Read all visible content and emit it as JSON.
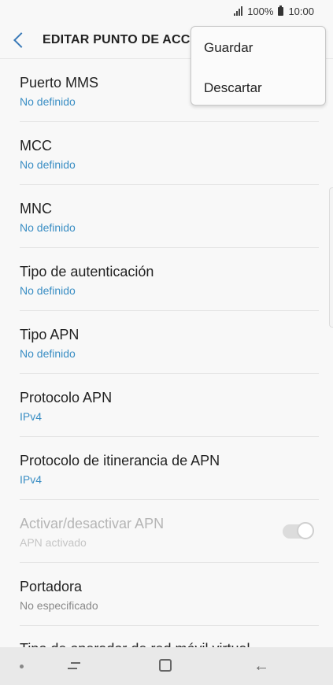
{
  "status": {
    "battery": "100%",
    "time": "10:00"
  },
  "header": {
    "title": "EDITAR PUNTO DE ACCE"
  },
  "menu": {
    "items": [
      "Guardar",
      "Descartar"
    ]
  },
  "settings": {
    "items": [
      {
        "label": "Puerto MMS",
        "value": "No definido"
      },
      {
        "label": "MCC",
        "value": "No definido"
      },
      {
        "label": "MNC",
        "value": "No definido"
      },
      {
        "label": "Tipo de autenticación",
        "value": "No definido"
      },
      {
        "label": "Tipo APN",
        "value": "No definido"
      },
      {
        "label": "Protocolo APN",
        "value": "IPv4"
      },
      {
        "label": "Protocolo de itinerancia de APN",
        "value": "IPv4"
      },
      {
        "label": "Activar/desactivar APN",
        "value": "APN activado",
        "toggle": true
      },
      {
        "label": "Portadora",
        "value": "No especificado"
      }
    ],
    "partial_label": "Tipo de operador de red móvil virtual"
  }
}
